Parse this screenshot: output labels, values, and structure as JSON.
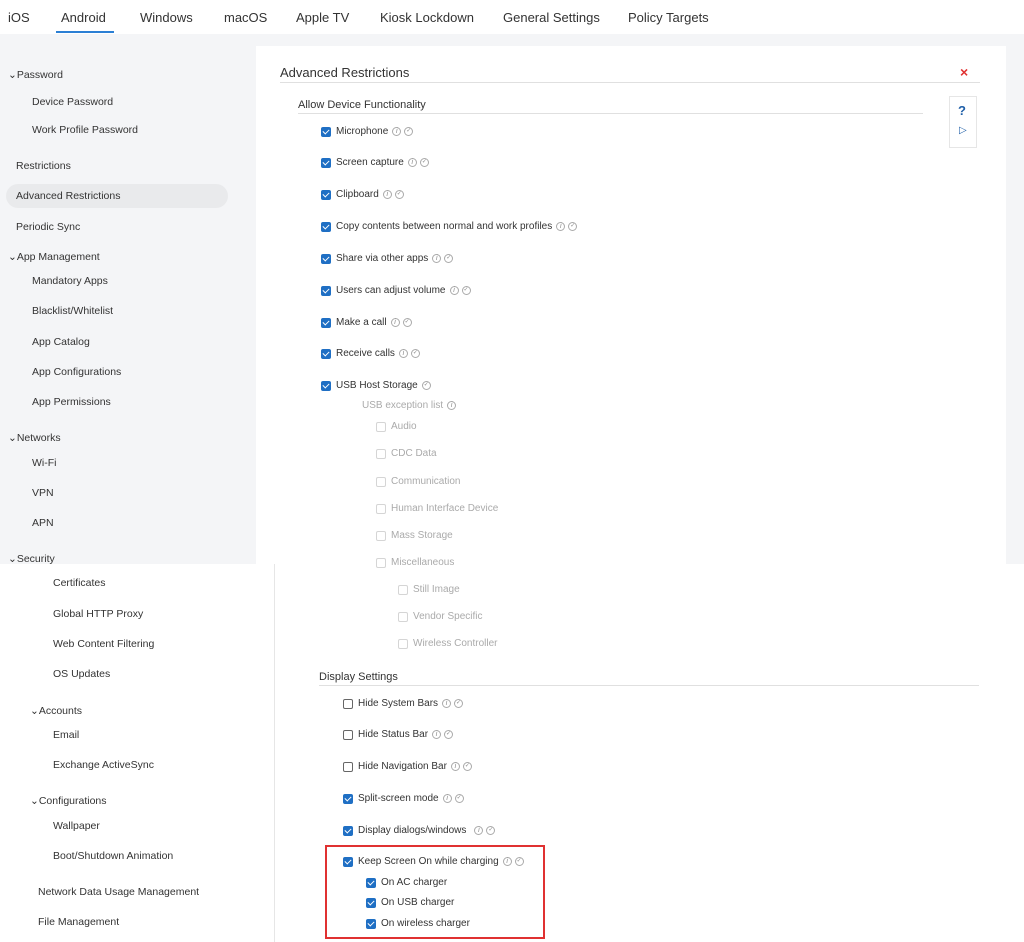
{
  "tabs": [
    "iOS",
    "Android",
    "Windows",
    "macOS",
    "Apple TV",
    "Kiosk Lockdown",
    "General Settings",
    "Policy Targets"
  ],
  "sidebar": {
    "password_group": "Password",
    "device_password": "Device Password",
    "work_profile_password": "Work Profile Password",
    "restrictions": "Restrictions",
    "advanced_restrictions": "Advanced Restrictions",
    "periodic_sync": "Periodic Sync",
    "app_management_group": "App Management",
    "mandatory_apps": "Mandatory Apps",
    "blacklist_whitelist": "Blacklist/Whitelist",
    "app_catalog": "App Catalog",
    "app_configurations": "App Configurations",
    "app_permissions": "App Permissions",
    "networks_group": "Networks",
    "wifi": "Wi-Fi",
    "vpn": "VPN",
    "apn": "APN",
    "security_group": "Security",
    "certificates": "Certificates",
    "global_http_proxy": "Global HTTP Proxy",
    "web_content_filtering": "Web Content Filtering",
    "os_updates": "OS Updates",
    "accounts_group": "Accounts",
    "email": "Email",
    "exchange_activesync": "Exchange ActiveSync",
    "configurations_group": "Configurations",
    "wallpaper": "Wallpaper",
    "boot_shutdown_animation": "Boot/Shutdown Animation",
    "network_data_usage": "Network Data Usage Management",
    "file_management": "File Management"
  },
  "content": {
    "title": "Advanced Restrictions",
    "close": "×",
    "allow_device_functionality": "Allow Device Functionality",
    "microphone": "Microphone",
    "screen_capture": "Screen capture",
    "clipboard": "Clipboard",
    "copy_contents": "Copy contents between normal and work profiles",
    "share_via_other_apps": "Share via other apps",
    "users_adjust_volume": "Users can adjust volume",
    "make_a_call": "Make a call",
    "receive_calls": "Receive calls",
    "usb_host_storage": "USB Host Storage",
    "usb_exception_list": "USB exception list",
    "usb_audio": "Audio",
    "usb_cdc_data": "CDC Data",
    "usb_communication": "Communication",
    "usb_hid": "Human Interface Device",
    "usb_mass_storage": "Mass Storage",
    "usb_miscellaneous": "Miscellaneous",
    "usb_still_image": "Still Image",
    "usb_vendor_specific": "Vendor Specific",
    "usb_wireless_controller": "Wireless Controller",
    "display_settings": "Display Settings",
    "hide_system_bars": "Hide System Bars",
    "hide_status_bar": "Hide Status Bar",
    "hide_navigation_bar": "Hide Navigation Bar",
    "split_screen_mode": "Split-screen mode",
    "display_dialogs_windows": "Display dialogs/windows",
    "keep_screen_on": "Keep Screen On while charging",
    "on_ac_charger": "On AC charger",
    "on_usb_charger": "On USB charger",
    "on_wireless_charger": "On wireless charger"
  },
  "help": {
    "question": "?",
    "play": "▷"
  },
  "colors": {
    "accent": "#1f6fc4",
    "close_red": "#e03131",
    "highlight_box": "#e03131"
  }
}
